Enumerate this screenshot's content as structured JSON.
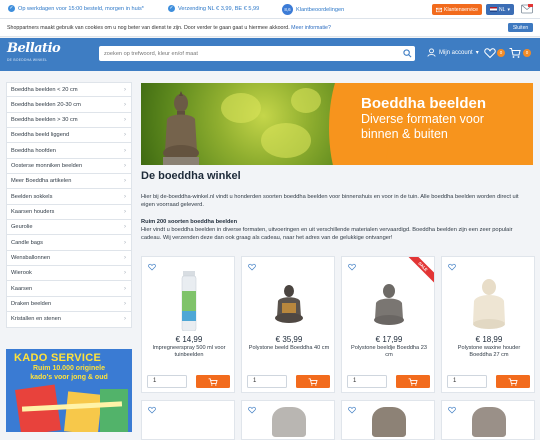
{
  "topbar": {
    "usp1": "Op werkdagen voor 15:00 besteld, morgen in huis*",
    "usp2": "Verzending NL € 3,99, BE € 5,99",
    "rating_score": "8,6",
    "usp3": "Klantbeoordelingen",
    "customer_service": "Klantenservice",
    "language": "NL"
  },
  "cookie": {
    "text": "Shoppartners maakt gebruik van cookies om u nog beter van dienst te zijn. Door verder te gaan gaat u hiermee akkoord.",
    "more": "Meer informatie?",
    "close": "Sluiten"
  },
  "header": {
    "logo": "Bellatio",
    "logo_sub": "DE BOEDDHA WINKEL",
    "search_placeholder": "zoeken op trefwoord, kleur en/of maat",
    "account": "Mijn account",
    "wishlist_count": "0",
    "cart_count": "0"
  },
  "sidebar": {
    "items": [
      "Boeddha beelden < 20 cm",
      "Boeddha beelden 20-30 cm",
      "Boeddha beelden > 30 cm",
      "Boeddha beeld liggend",
      "Boeddha hoofden",
      "Oosterse monniken beelden",
      "Meer Boeddha artikelen",
      "Beelden sokkels",
      "Kaarsen houders",
      "Geurolie",
      "Candle bags",
      "Wensballonnen",
      "Wierook",
      "Kaarsen",
      "Draken beelden",
      "Kristallen en stenen"
    ]
  },
  "kado": {
    "title": "KADO SERVICE",
    "line1": "Ruim 10.000 originele",
    "line2": "kado's voor jong & oud"
  },
  "banner": {
    "title": "Boeddha beelden",
    "line1": "Diverse formaten voor",
    "line2": "binnen & buiten"
  },
  "main": {
    "title": "De boeddha winkel",
    "p1": "Hier bij de-boeddha-winkel.nl vindt u honderden soorten boeddha beelden voor binnenshuis en voor in de tuin. Alle boeddha beelden worden direct uit eigen voorraad geleverd.",
    "subtitle": "Ruim 200 soorten boeddha beelden",
    "p2": "Hier vindt u boeddha beelden in diverse formaten, uitvoeringen en uit verschillende materialen vervaardigd. Boeddha beelden zijn een zeer populair cadeau. Wij verzenden deze dan ook graag als cadeau, naar het adres van de gelukkige ontvanger!"
  },
  "products": [
    {
      "price": "€ 14,99",
      "name": "Impregneerspray 500 ml voor tuinbeelden",
      "qty": "1",
      "sale": ""
    },
    {
      "price": "€ 35,99",
      "name": "Polystone beeld Boeddha 40 cm",
      "qty": "1",
      "sale": ""
    },
    {
      "price": "€ 17,99",
      "name": "Polystone beeldje Boeddha 23 cm",
      "qty": "1",
      "sale": "SALE"
    },
    {
      "price": "€ 18,99",
      "name": "Polystone waxine houder Boeddha 27 cm",
      "qty": "1",
      "sale": ""
    }
  ],
  "colors": {
    "brand_blue": "#3e7dc3",
    "accent_orange": "#f26b1d",
    "banner_orange": "#f7941d",
    "sale_red": "#e23535"
  }
}
